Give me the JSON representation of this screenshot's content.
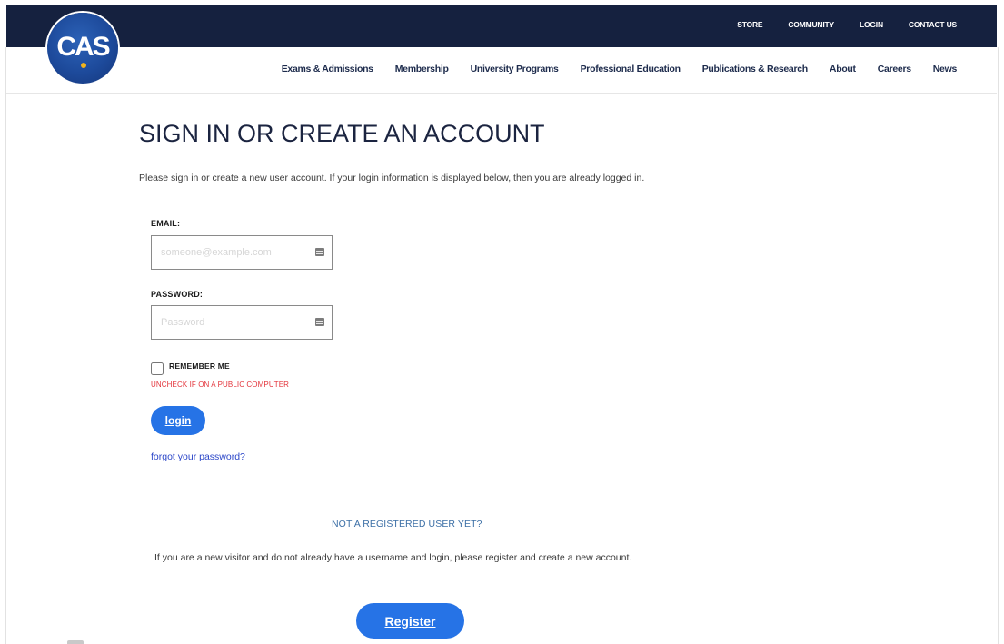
{
  "brand": {
    "logo_text": "CAS",
    "navy": "#15213f",
    "logo_blue": "#1d4a9b",
    "accent_gold": "#f2b41c",
    "button_blue": "#2673e6",
    "warning_red": "#e3343b"
  },
  "topbar": {
    "links": [
      "STORE",
      "COMMUNITY",
      "LOGIN",
      "CONTACT US"
    ]
  },
  "mainnav": {
    "links": [
      "Exams & Admissions",
      "Membership",
      "University Programs",
      "Professional Education",
      "Publications & Research",
      "About",
      "Careers",
      "News"
    ]
  },
  "content": {
    "title": "SIGN IN OR CREATE AN ACCOUNT",
    "intro": "Please sign in or create a new user account. If your login information is displayed below, then you are already logged in."
  },
  "login_form": {
    "email_label": "EMAIL:",
    "email_placeholder": "someone@example.com",
    "email_value": "",
    "email_icon": "id-card-icon",
    "password_label": "PASSWORD:",
    "password_placeholder": "Password",
    "password_value": "",
    "password_icon": "id-card-icon",
    "remember_label": "REMEMBER ME",
    "remember_checked": false,
    "remember_hint": "UNCHECK IF ON A PUBLIC COMPUTER",
    "login_button": "login",
    "forgot_link": "forgot your password?"
  },
  "register": {
    "heading": "NOT A REGISTERED USER YET?",
    "text": "If you are a new visitor and do not already have a username and login, please register and create a new account.",
    "button": "Register"
  }
}
